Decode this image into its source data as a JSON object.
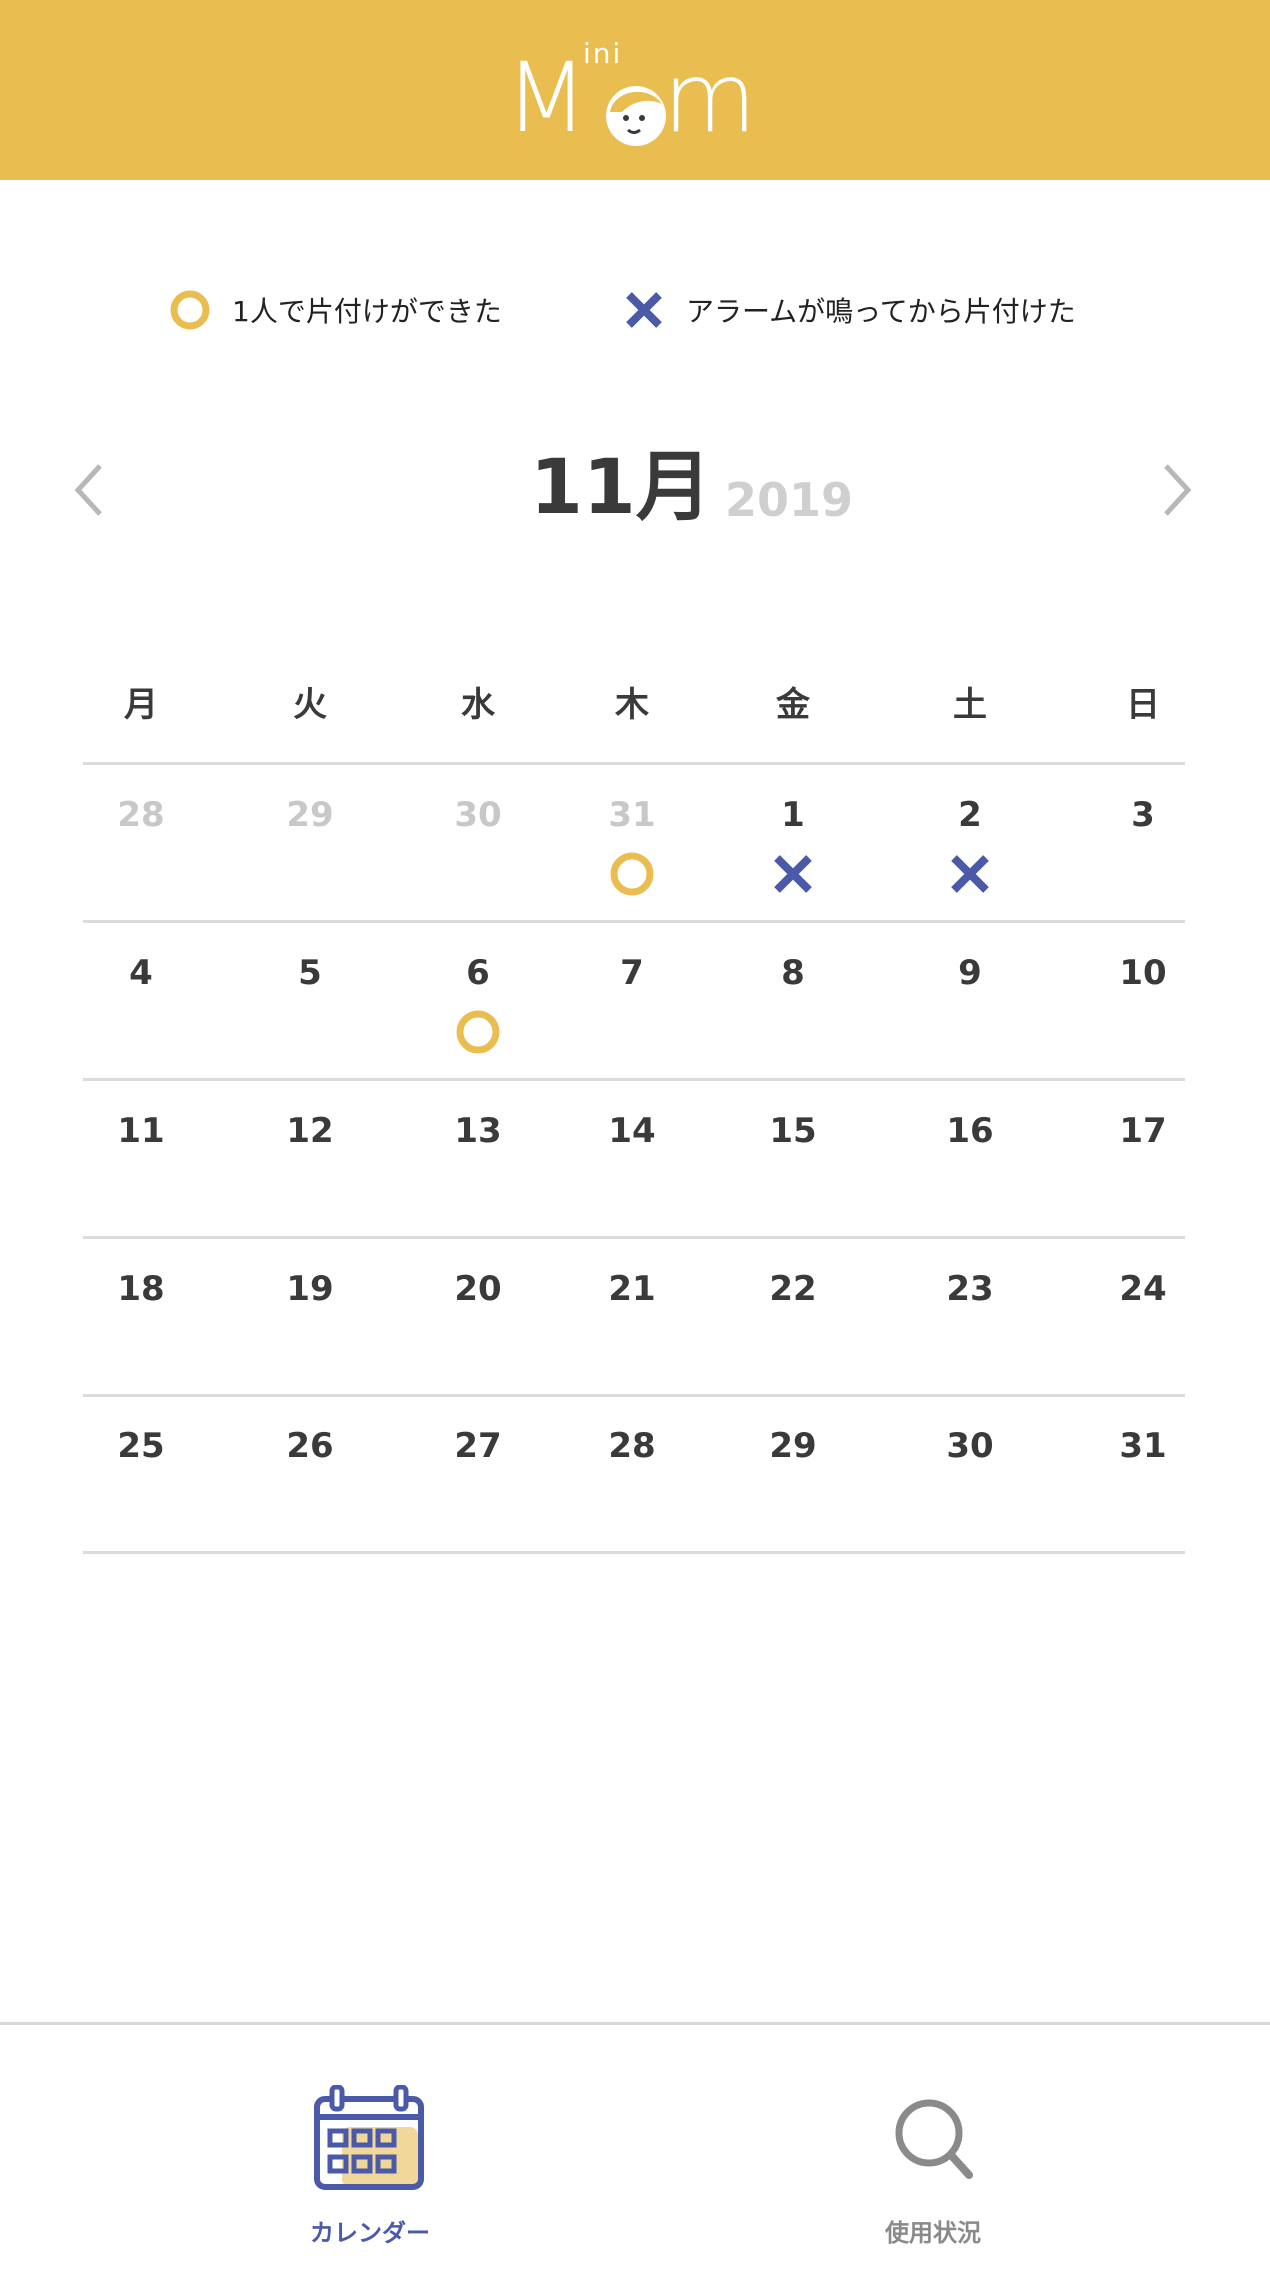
{
  "app": {
    "logo_text_left": "M",
    "logo_text_right": "m",
    "logo_superscript": "ini"
  },
  "legend": {
    "success_label": "1人で片付けができた",
    "alarm_label": "アラームが鳴ってから片付けた"
  },
  "calendar": {
    "month_label": "11月",
    "year_label": "2019",
    "weekdays": [
      "月",
      "火",
      "水",
      "木",
      "金",
      "土",
      "日"
    ],
    "weeks": [
      [
        {
          "day": "28",
          "muted": true,
          "mark": ""
        },
        {
          "day": "29",
          "muted": true,
          "mark": ""
        },
        {
          "day": "30",
          "muted": true,
          "mark": ""
        },
        {
          "day": "31",
          "muted": true,
          "mark": "circle"
        },
        {
          "day": "1",
          "muted": false,
          "mark": "cross"
        },
        {
          "day": "2",
          "muted": false,
          "mark": "cross"
        },
        {
          "day": "3",
          "muted": false,
          "mark": ""
        }
      ],
      [
        {
          "day": "4",
          "muted": false,
          "mark": ""
        },
        {
          "day": "5",
          "muted": false,
          "mark": ""
        },
        {
          "day": "6",
          "muted": false,
          "mark": "circle"
        },
        {
          "day": "7",
          "muted": false,
          "mark": ""
        },
        {
          "day": "8",
          "muted": false,
          "mark": ""
        },
        {
          "day": "9",
          "muted": false,
          "mark": ""
        },
        {
          "day": "10",
          "muted": false,
          "mark": ""
        }
      ],
      [
        {
          "day": "11",
          "muted": false,
          "mark": ""
        },
        {
          "day": "12",
          "muted": false,
          "mark": ""
        },
        {
          "day": "13",
          "muted": false,
          "mark": ""
        },
        {
          "day": "14",
          "muted": false,
          "mark": ""
        },
        {
          "day": "15",
          "muted": false,
          "mark": ""
        },
        {
          "day": "16",
          "muted": false,
          "mark": ""
        },
        {
          "day": "17",
          "muted": false,
          "mark": ""
        }
      ],
      [
        {
          "day": "18",
          "muted": false,
          "mark": ""
        },
        {
          "day": "19",
          "muted": false,
          "mark": ""
        },
        {
          "day": "20",
          "muted": false,
          "mark": ""
        },
        {
          "day": "21",
          "muted": false,
          "mark": ""
        },
        {
          "day": "22",
          "muted": false,
          "mark": ""
        },
        {
          "day": "23",
          "muted": false,
          "mark": ""
        },
        {
          "day": "24",
          "muted": false,
          "mark": ""
        }
      ],
      [
        {
          "day": "25",
          "muted": false,
          "mark": ""
        },
        {
          "day": "26",
          "muted": false,
          "mark": ""
        },
        {
          "day": "27",
          "muted": false,
          "mark": ""
        },
        {
          "day": "28",
          "muted": false,
          "mark": ""
        },
        {
          "day": "29",
          "muted": false,
          "mark": ""
        },
        {
          "day": "30",
          "muted": false,
          "mark": ""
        },
        {
          "day": "31",
          "muted": false,
          "mark": ""
        }
      ]
    ]
  },
  "tabbar": {
    "calendar_label": "カレンダー",
    "usage_label": "使用状況"
  },
  "colors": {
    "header": "#e9bd4f",
    "circle_mark": "#e9bd4f",
    "cross_mark": "#4a5aa8",
    "active_tab": "#4a5aa8",
    "inactive_tab": "#8a8a8a"
  },
  "icons": {
    "prev": "chevron-left-icon",
    "next": "chevron-right-icon",
    "calendar_tab": "calendar-icon",
    "usage_tab": "search-icon"
  }
}
